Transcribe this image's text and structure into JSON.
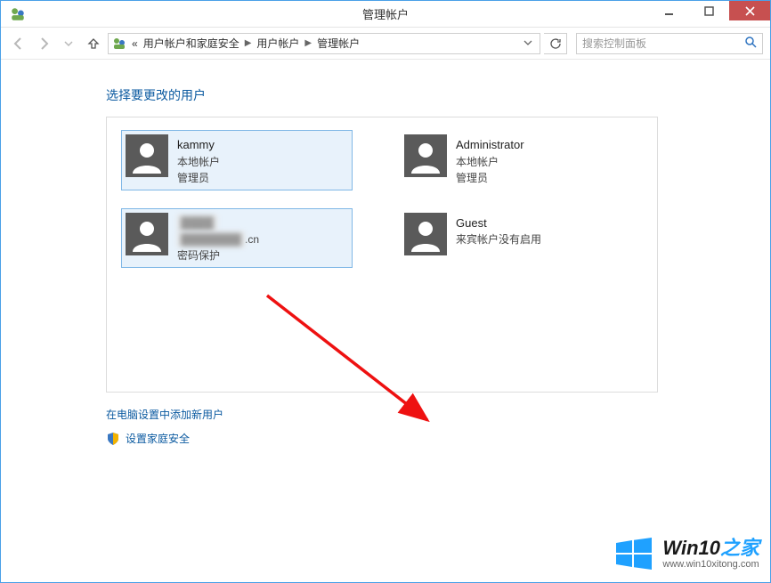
{
  "window": {
    "title": "管理帐户"
  },
  "breadcrumb": {
    "prefix": "«",
    "items": [
      {
        "label": "用户帐户和家庭安全"
      },
      {
        "label": "用户帐户"
      },
      {
        "label": "管理帐户"
      }
    ]
  },
  "search": {
    "placeholder": "搜索控制面板"
  },
  "page": {
    "heading": "选择要更改的用户"
  },
  "users": [
    {
      "id": "kammy",
      "name": "kammy",
      "line1": "本地帐户",
      "line2": "管理员",
      "selected": true
    },
    {
      "id": "administrator",
      "name": "Administrator",
      "line1": "本地帐户",
      "line2": "管理员",
      "selected": false
    },
    {
      "id": "redacted",
      "name": "",
      "email_suffix": ".cn",
      "line2": "密码保护",
      "selected": true,
      "redacted": true
    },
    {
      "id": "guest",
      "name": "Guest",
      "line1": "来宾帐户没有启用",
      "selected": false
    }
  ],
  "links": {
    "add_user": "在电脑设置中添加新用户",
    "family_safety": "设置家庭安全"
  },
  "watermark": {
    "brand_prefix": "Win10",
    "brand_suffix": "之家",
    "url": "www.win10xitong.com"
  },
  "icons": {
    "back": "back-arrow-icon",
    "forward": "forward-arrow-icon",
    "up": "up-arrow-icon",
    "dropdown": "chevron-down-icon",
    "refresh": "refresh-icon",
    "search": "search-icon",
    "shield": "shield-icon",
    "user_accounts": "user-accounts-icon"
  }
}
